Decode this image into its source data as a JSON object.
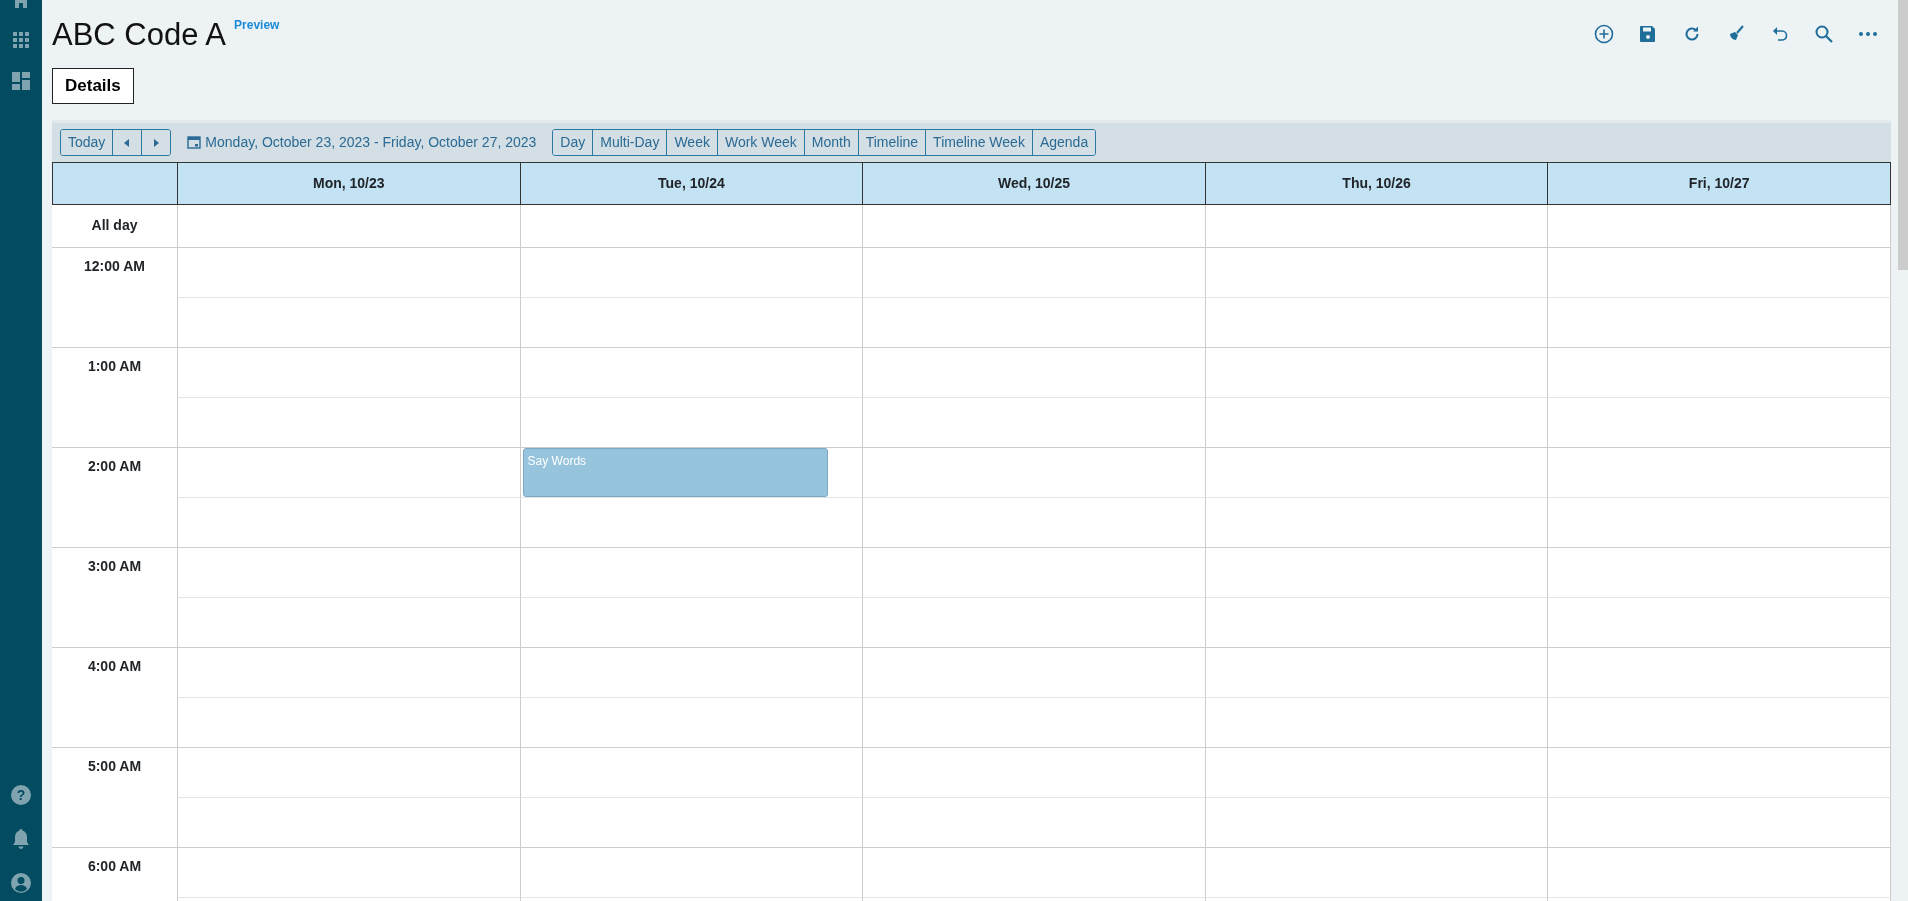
{
  "page": {
    "title": "ABC Code A",
    "badge": "Preview"
  },
  "tabs": [
    {
      "label": "Details",
      "selected": true
    }
  ],
  "toolbar": {
    "today": "Today",
    "date_range": "Monday, October 23, 2023 - Friday, October 27, 2023",
    "views": [
      "Day",
      "Multi-Day",
      "Week",
      "Work Week",
      "Month",
      "Timeline",
      "Timeline Week",
      "Agenda"
    ]
  },
  "calendar": {
    "days": [
      "Mon, 10/23",
      "Tue, 10/24",
      "Wed, 10/25",
      "Thu, 10/26",
      "Fri, 10/27"
    ],
    "all_day_label": "All day",
    "hours": [
      {
        "label": "12:00 AM"
      },
      {
        "label": "1:00 AM"
      },
      {
        "label": "2:00 AM",
        "slots": [
          {
            "kind": "empty"
          },
          {
            "kind": "event",
            "title": "Say Words"
          },
          {
            "kind": "empty"
          },
          {
            "kind": "empty"
          },
          {
            "kind": "empty"
          }
        ]
      },
      {
        "label": "3:00 AM"
      },
      {
        "label": "4:00 AM"
      },
      {
        "label": "5:00 AM"
      },
      {
        "label": "6:00 AM"
      }
    ]
  },
  "sidebar": {
    "help_glyph": "?"
  }
}
